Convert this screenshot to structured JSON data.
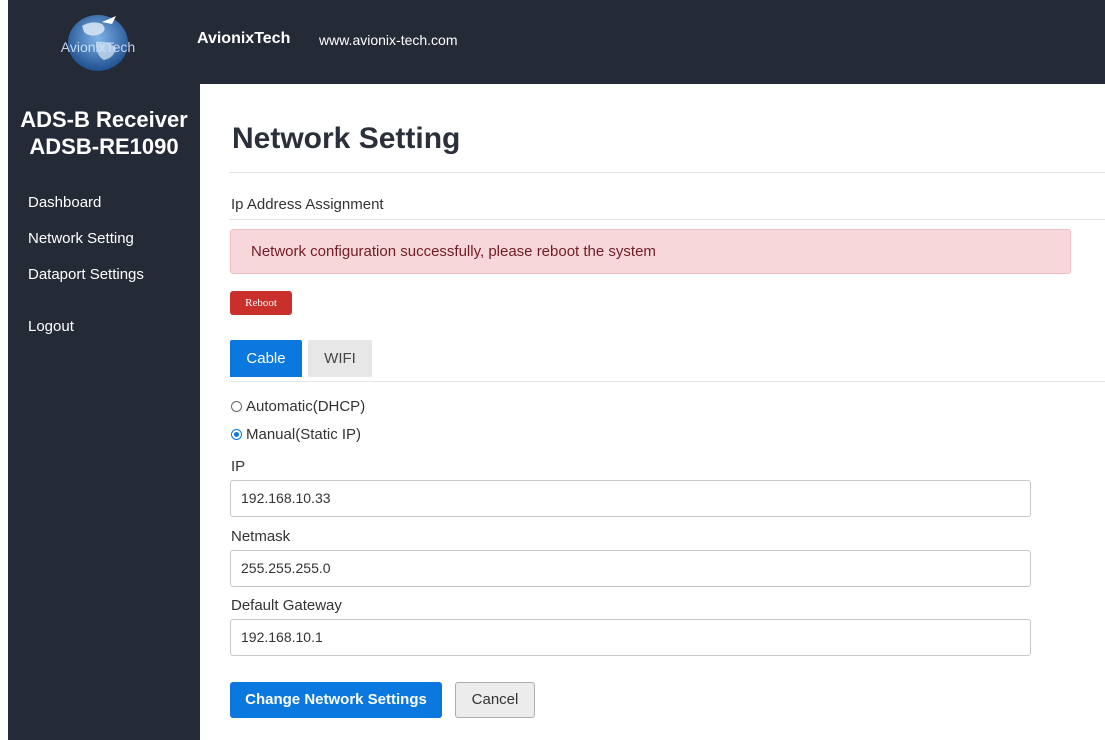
{
  "header": {
    "logo_text": "AvionixTech",
    "brand": "AvionixTech",
    "site": "www.avionix-tech.com"
  },
  "sidebar": {
    "product_line1": "ADS-B Receiver",
    "product_line2": "ADSB-RE1090",
    "items": [
      {
        "label": "Dashboard"
      },
      {
        "label": "Network Setting"
      },
      {
        "label": "Dataport Settings"
      },
      {
        "label": "Logout"
      }
    ]
  },
  "main": {
    "title": "Network Setting",
    "section_label": "Ip Address Assignment",
    "alert": "Network configuration successfully, please reboot the system",
    "reboot_label": "Reboot",
    "tabs": [
      {
        "label": "Cable",
        "active": true
      },
      {
        "label": "WIFI",
        "active": false
      }
    ],
    "radio_options": [
      {
        "label": "Automatic(DHCP)",
        "checked": false
      },
      {
        "label": "Manual(Static IP)",
        "checked": true
      }
    ],
    "fields": [
      {
        "label": "IP",
        "value": "192.168.10.33"
      },
      {
        "label": "Netmask",
        "value": "255.255.255.0"
      },
      {
        "label": "Default Gateway",
        "value": "192.168.10.1"
      }
    ],
    "submit_label": "Change Network Settings",
    "cancel_label": "Cancel"
  },
  "colors": {
    "sidebar_bg": "#252a37",
    "accent": "#0b78df",
    "alert_bg": "#f8d7da",
    "danger": "#c9302c"
  },
  "icons": [
    "globe-logo-icon",
    "radio-unchecked-icon",
    "radio-checked-icon"
  ]
}
